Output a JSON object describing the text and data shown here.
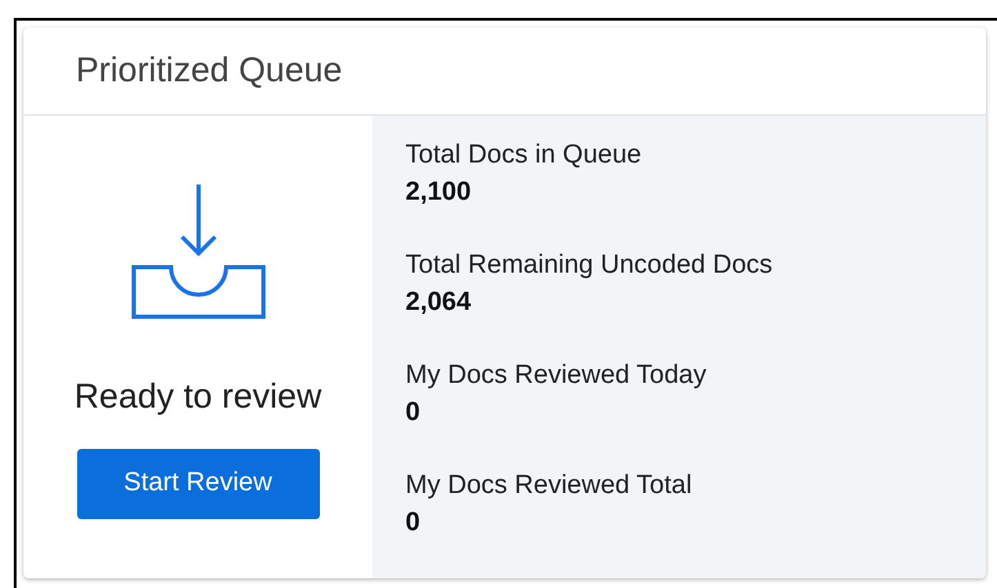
{
  "card": {
    "title": "Prioritized Queue"
  },
  "status": {
    "text": "Ready to review",
    "button": "Start Review"
  },
  "stats": [
    {
      "label": "Total Docs in Queue",
      "value": "2,100"
    },
    {
      "label": "Total Remaining Uncoded Docs",
      "value": "2,064"
    },
    {
      "label": "My Docs Reviewed Today",
      "value": "0"
    },
    {
      "label": "My Docs Reviewed Total",
      "value": "0"
    }
  ]
}
